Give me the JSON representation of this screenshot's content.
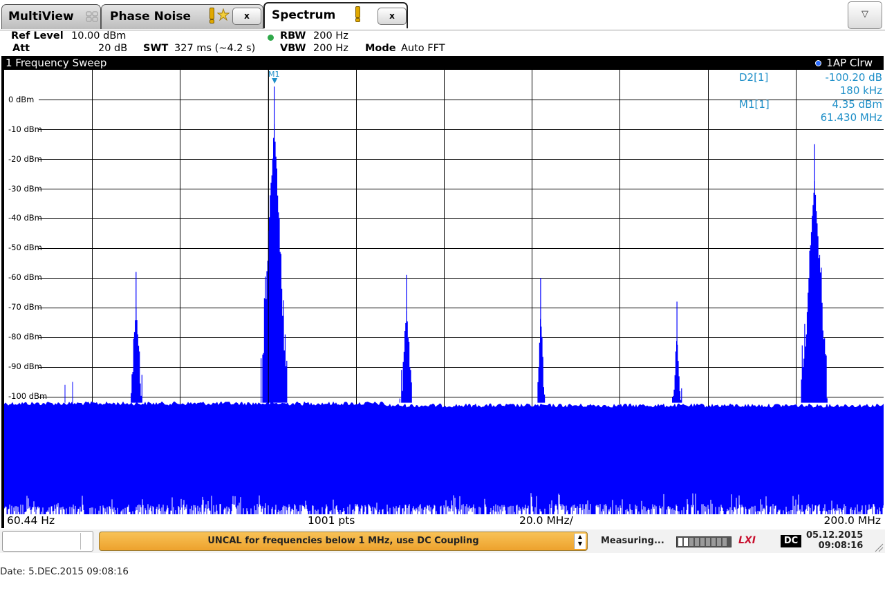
{
  "tabs": [
    {
      "label": "MultiView",
      "icon": "multiview-grid-icon"
    },
    {
      "label": "Phase Noise",
      "icon": "warning-icon",
      "close": "x"
    },
    {
      "label": "Spectrum",
      "icon": "warning-icon",
      "close": "x",
      "active": true
    }
  ],
  "settings": {
    "ref_level_label": "Ref Level",
    "ref_level_value": "10.00 dBm",
    "att_label": "Att",
    "att_value": "20 dB",
    "swt_label": "SWT",
    "swt_value": "327 ms (~4.2 s)",
    "rbw_label": "RBW",
    "rbw_value": "200 Hz",
    "vbw_label": "VBW",
    "vbw_value": "200 Hz",
    "mode_label": "Mode",
    "mode_value": "Auto FFT"
  },
  "diagram": {
    "title": "1 Frequency Sweep",
    "trace_label": "1AP Clrw",
    "y_labels": [
      "0 dBm",
      "-10 dBm",
      "-20 dBm",
      "-30 dBm",
      "-40 dBm",
      "-50 dBm",
      "-60 dBm",
      "-70 dBm",
      "-80 dBm",
      "-90 dBm",
      "-100 dBm"
    ],
    "marker_label": "M1",
    "marker_table": [
      {
        "name": "D2[1]",
        "value1": "-100.20 dB",
        "value2": "180 kHz"
      },
      {
        "name": "M1[1]",
        "value1": "4.35 dBm",
        "value2": "61.430 MHz"
      }
    ],
    "x_start": "60.44 Hz",
    "x_points": "1001 pts",
    "x_div": "20.0 MHz/",
    "x_stop": "200.0 MHz"
  },
  "chart_data": {
    "type": "line",
    "title": "1 Frequency Sweep",
    "xlabel": "",
    "ylabel": "",
    "xlim": [
      0,
      200
    ],
    "ylim": [
      -140,
      10
    ],
    "grid": true,
    "noise_floor_dbm": -102,
    "peaks_mhz": [
      30.0,
      61.43,
      91.5,
      122.0,
      153.0,
      184.3
    ],
    "peaks_dbm": [
      -58,
      4.35,
      -59,
      -60,
      -68,
      -15
    ],
    "peak_widths_mhz": [
      1.5,
      3.0,
      1.5,
      1.0,
      1.2,
      3.0
    ]
  },
  "status": {
    "message": "UNCAL for frequencies below 1 MHz, use DC Coupling",
    "measuring": "Measuring...",
    "lxi": "LXI",
    "coupling": "DC",
    "date": "05.12.2015",
    "time": "09:08:16"
  },
  "footer": {
    "date_line": "Date: 5.DEC.2015  09:08:16"
  },
  "colors": {
    "trace": "#0000ff",
    "marker": "#1e8fc8",
    "message_bg": "#f0a830"
  }
}
